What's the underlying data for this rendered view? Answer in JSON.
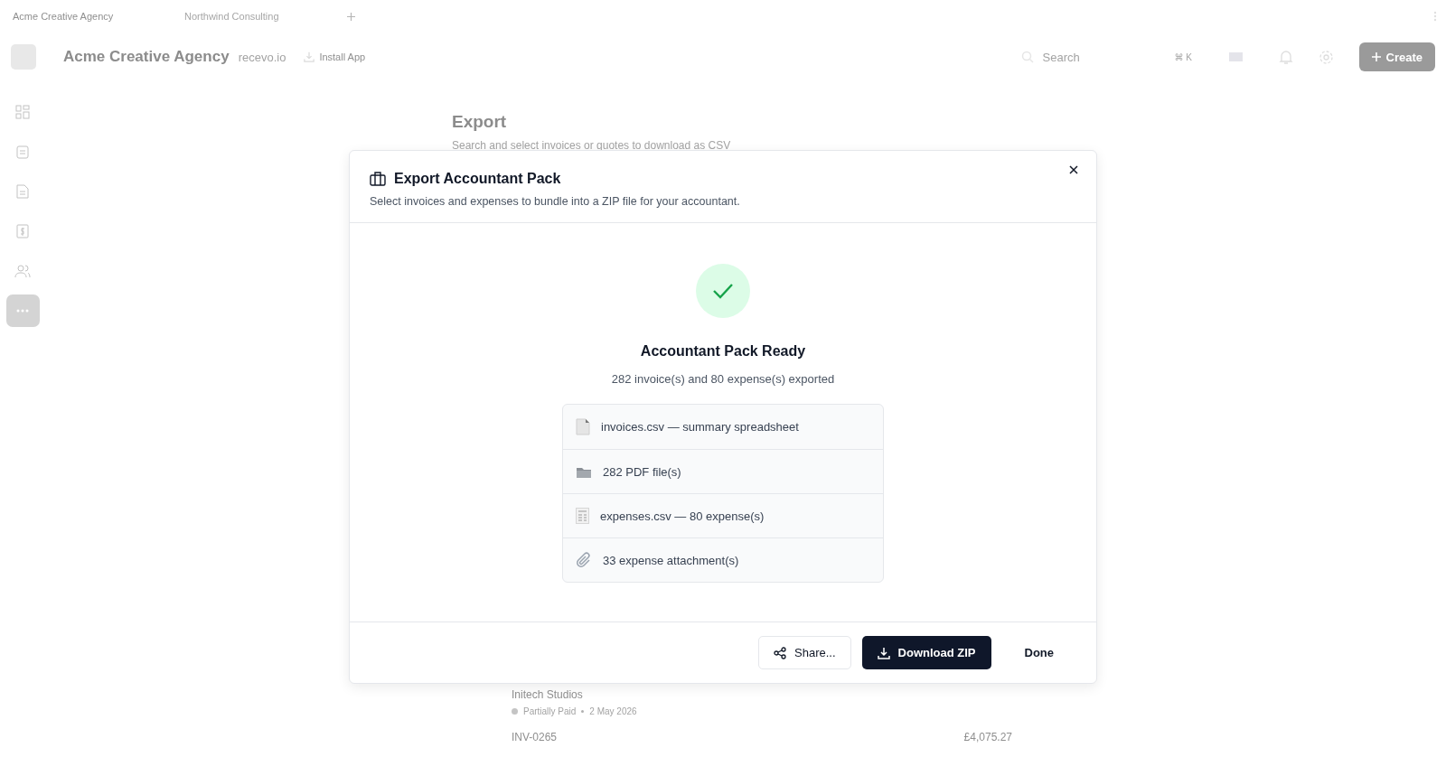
{
  "tabs": [
    {
      "label": "Acme Creative Agency",
      "selected": true
    },
    {
      "label": "Northwind Consulting",
      "selected": false
    }
  ],
  "header": {
    "workspace": "Acme Creative Agency",
    "domain": "recevo.io",
    "install": "Install App",
    "search_placeholder": "Search",
    "shortcut": "⌘ K",
    "create": "Create"
  },
  "sidebar": {
    "items": [
      {
        "kind": "grid",
        "selected": false
      },
      {
        "kind": "clipboard",
        "selected": false
      },
      {
        "kind": "document",
        "selected": false
      },
      {
        "kind": "dollar",
        "selected": false
      },
      {
        "kind": "users",
        "selected": false
      },
      {
        "kind": "more",
        "selected": true
      }
    ]
  },
  "page": {
    "title": "Export",
    "subtitle": "Search and select invoices or quotes to download as CSV",
    "rows": [
      {
        "client": "Initech Studios",
        "status": "Partially Paid",
        "date": "2 May 2026",
        "color": "#c4c4c4"
      },
      {
        "number": "INV-0265",
        "amount": "£4,075.27"
      }
    ]
  },
  "dialog": {
    "title": "Export Accountant Pack",
    "description": "Select invoices and expenses to bundle into a ZIP file for your accountant.",
    "result_title": "Accountant Pack Ready",
    "result_summary": "282 invoice(s) and 80 expense(s) exported",
    "files": [
      {
        "kind": "document",
        "label": "invoices.csv — summary spreadsheet"
      },
      {
        "kind": "folder",
        "label": "282 PDF file(s)"
      },
      {
        "kind": "receipt",
        "label": "expenses.csv — 80 expense(s)"
      },
      {
        "kind": "paperclip",
        "label": "33 expense attachment(s)"
      }
    ],
    "buttons": [
      {
        "kind": "share",
        "label": "Share..."
      },
      {
        "kind": "download",
        "label": "Download ZIP"
      },
      {
        "kind": "done",
        "label": "Done"
      }
    ]
  }
}
